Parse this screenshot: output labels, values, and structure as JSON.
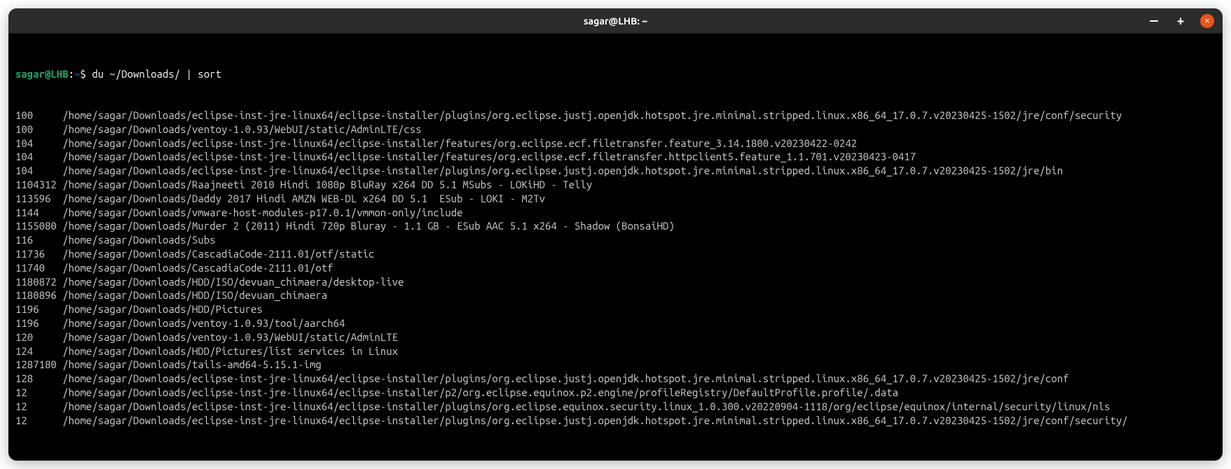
{
  "window": {
    "title": "sagar@LHB: ~"
  },
  "prompt": {
    "user_host": "sagar@LHB",
    "colon": ":",
    "path": "~",
    "dollar": "$ ",
    "command": "du ~/Downloads/ | sort"
  },
  "output": [
    {
      "size": "100",
      "path": "/home/sagar/Downloads/eclipse-inst-jre-linux64/eclipse-installer/plugins/org.eclipse.justj.openjdk.hotspot.jre.minimal.stripped.linux.x86_64_17.0.7.v20230425-1502/jre/conf/security"
    },
    {
      "size": "100",
      "path": "/home/sagar/Downloads/ventoy-1.0.93/WebUI/static/AdminLTE/css"
    },
    {
      "size": "104",
      "path": "/home/sagar/Downloads/eclipse-inst-jre-linux64/eclipse-installer/features/org.eclipse.ecf.filetransfer.feature_3.14.1800.v20230422-0242"
    },
    {
      "size": "104",
      "path": "/home/sagar/Downloads/eclipse-inst-jre-linux64/eclipse-installer/features/org.eclipse.ecf.filetransfer.httpclient5.feature_1.1.701.v20230423-0417"
    },
    {
      "size": "104",
      "path": "/home/sagar/Downloads/eclipse-inst-jre-linux64/eclipse-installer/plugins/org.eclipse.justj.openjdk.hotspot.jre.minimal.stripped.linux.x86_64_17.0.7.v20230425-1502/jre/bin"
    },
    {
      "size": "1104312",
      "path": "/home/sagar/Downloads/Raajneeti 2010 Hindi 1080p BluRay x264 DD 5.1 MSubs - LOKiHD - Telly"
    },
    {
      "size": "113596",
      "path": "/home/sagar/Downloads/Daddy 2017 Hindi AMZN WEB-DL x264 DD 5.1  ESub - LOKI - M2Tv"
    },
    {
      "size": "1144",
      "path": "/home/sagar/Downloads/vmware-host-modules-p17.0.1/vmmon-only/include"
    },
    {
      "size": "1155080",
      "path": "/home/sagar/Downloads/Murder 2 (2011) Hindi 720p Bluray - 1.1 GB - ESub AAC 5.1 x264 - Shadow (BonsaiHD)"
    },
    {
      "size": "116",
      "path": "/home/sagar/Downloads/Subs"
    },
    {
      "size": "11736",
      "path": "/home/sagar/Downloads/CascadiaCode-2111.01/otf/static"
    },
    {
      "size": "11740",
      "path": "/home/sagar/Downloads/CascadiaCode-2111.01/otf"
    },
    {
      "size": "1180872",
      "path": "/home/sagar/Downloads/HDD/ISO/devuan_chimaera/desktop-live"
    },
    {
      "size": "1180896",
      "path": "/home/sagar/Downloads/HDD/ISO/devuan_chimaera"
    },
    {
      "size": "1196",
      "path": "/home/sagar/Downloads/HDD/Pictures"
    },
    {
      "size": "1196",
      "path": "/home/sagar/Downloads/ventoy-1.0.93/tool/aarch64"
    },
    {
      "size": "120",
      "path": "/home/sagar/Downloads/ventoy-1.0.93/WebUI/static/AdminLTE"
    },
    {
      "size": "124",
      "path": "/home/sagar/Downloads/HDD/Pictures/list services in Linux"
    },
    {
      "size": "1287180",
      "path": "/home/sagar/Downloads/tails-amd64-5.15.1-img"
    },
    {
      "size": "128",
      "path": "/home/sagar/Downloads/eclipse-inst-jre-linux64/eclipse-installer/plugins/org.eclipse.justj.openjdk.hotspot.jre.minimal.stripped.linux.x86_64_17.0.7.v20230425-1502/jre/conf"
    },
    {
      "size": "12",
      "path": "/home/sagar/Downloads/eclipse-inst-jre-linux64/eclipse-installer/p2/org.eclipse.equinox.p2.engine/profileRegistry/DefaultProfile.profile/.data"
    },
    {
      "size": "12",
      "path": "/home/sagar/Downloads/eclipse-inst-jre-linux64/eclipse-installer/plugins/org.eclipse.equinox.security.linux_1.0.300.v20220904-1118/org/eclipse/equinox/internal/security/linux/nls"
    },
    {
      "size": "12",
      "path": "/home/sagar/Downloads/eclipse-inst-jre-linux64/eclipse-installer/plugins/org.eclipse.justj.openjdk.hotspot.jre.minimal.stripped.linux.x86_64_17.0.7.v20230425-1502/jre/conf/security/"
    }
  ]
}
